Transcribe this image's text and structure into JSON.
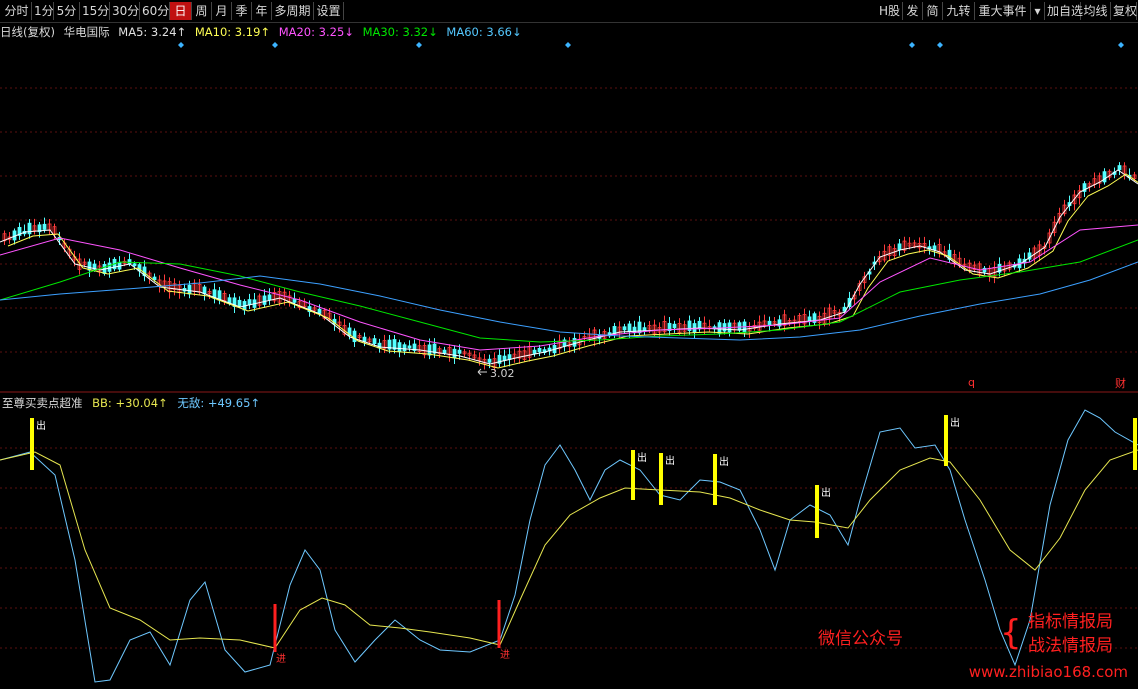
{
  "toolbar": {
    "left": [
      "分时",
      "1分",
      "5分",
      "15分",
      "30分",
      "60分",
      "日",
      "周",
      "月",
      "季",
      "年",
      "多周期",
      "设置"
    ],
    "active": "日",
    "right": [
      "H股",
      "发",
      "简",
      "九转",
      "重大事件",
      "▾",
      "加自选",
      "均线",
      "复权"
    ]
  },
  "info": {
    "period": "日线(复权)",
    "stock": "华电国际",
    "ma5": "MA5: 3.24↑",
    "ma10": "MA10: 3.19↑",
    "ma20": "MA20: 3.25↓",
    "ma30": "MA30: 3.32↓",
    "ma60": "MA60: 3.66↓"
  },
  "price_marks": {
    "low_label": "3.02",
    "q_mark": "q",
    "cai_mark": "财"
  },
  "indicator": {
    "name": "至尊买卖点超准",
    "bb": "BB: +30.04↑",
    "wudi": "无敌: +49.65↑",
    "sell_label": "出",
    "buy_label": "进"
  },
  "watermark": {
    "left": "微信公众号",
    "line1": "指标情报局",
    "line2": "战法情报局",
    "url": "www.zhibiao168.com"
  },
  "colors": {
    "up": "#ff3c3c",
    "down": "#54ffff",
    "ma5": "#ffffff",
    "ma10": "#ffff54",
    "ma20": "#ff54ff",
    "ma30": "#00e600",
    "ma60": "#3ca0ff",
    "bb": "#e6e650",
    "wudi": "#6ec8ff",
    "sell": "#ffff00",
    "buy": "#ff2020"
  }
}
